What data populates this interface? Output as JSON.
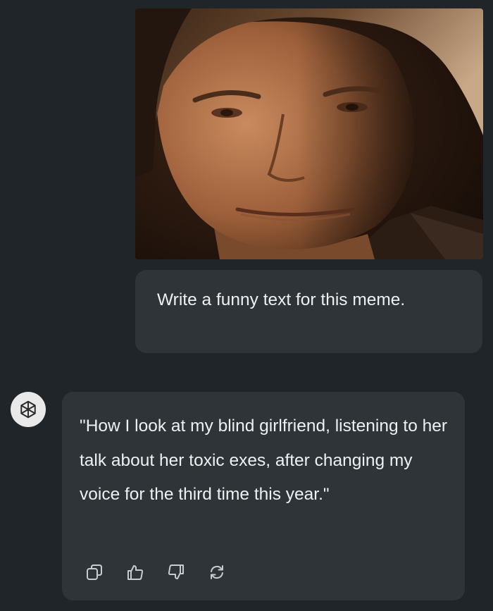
{
  "user_message": {
    "text": "Write a funny text for this meme."
  },
  "assistant_message": {
    "text": "\"How I look at my blind girlfriend, listening to her talk about her toxic exes, after changing my voice for the third time this year.\""
  },
  "actions": [
    {
      "name": "copy-button",
      "icon": "copy-icon"
    },
    {
      "name": "thumbs-up-button",
      "icon": "thumbs-up-icon"
    },
    {
      "name": "thumbs-down-button",
      "icon": "thumbs-down-icon"
    },
    {
      "name": "regenerate-button",
      "icon": "refresh-icon"
    }
  ],
  "colors": {
    "background": "#1f2528",
    "bubble": "#2e3438",
    "text": "#eef0f1",
    "icon": "#c7ccd0"
  }
}
